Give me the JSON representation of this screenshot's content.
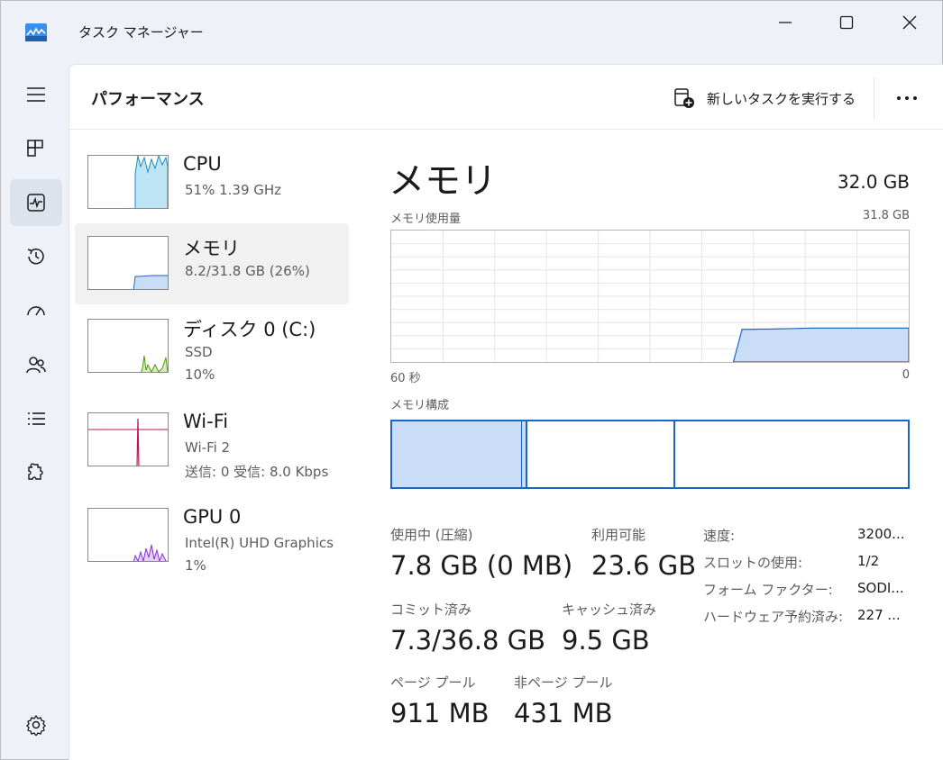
{
  "window": {
    "title": "タスク マネージャー"
  },
  "colors": {
    "accent": "#0b5cd5",
    "memory_line": "#1e65c2",
    "memory_fill": "#c9ddf7",
    "cpu_fill": "#bde5f5",
    "cpu_line": "#1d8bb8",
    "disk_line": "#4e9a06",
    "wifi_line": "#c0125e",
    "gpu_line": "#8a2be2"
  },
  "rail": {
    "items": [
      {
        "name": "menu-icon"
      },
      {
        "name": "processes-icon"
      },
      {
        "name": "performance-icon",
        "active": true
      },
      {
        "name": "app-history-icon"
      },
      {
        "name": "startup-apps-icon"
      },
      {
        "name": "users-icon"
      },
      {
        "name": "details-icon"
      },
      {
        "name": "services-icon"
      },
      {
        "name": "settings-icon"
      }
    ]
  },
  "header": {
    "title": "パフォーマンス",
    "run_task_label": "新しいタスクを実行する"
  },
  "perf_list": [
    {
      "name": "CPU",
      "sub1": "51%  1.39 GHz",
      "sub2": ""
    },
    {
      "name": "メモリ",
      "sub1": "8.2/31.8 GB (26%)",
      "sub2": ""
    },
    {
      "name": "ディスク 0 (C:)",
      "sub1": "SSD",
      "sub2": "10%"
    },
    {
      "name": "Wi-Fi",
      "sub1": "Wi-Fi 2",
      "sub2": "送信: 0  受信: 8.0 Kbps"
    },
    {
      "name": "GPU 0",
      "sub1": "Intel(R) UHD Graphics",
      "sub2": "1%"
    }
  ],
  "detail": {
    "title": "メモリ",
    "total": "32.0 GB",
    "usage_label": "メモリ使用量",
    "usage_max": "31.8 GB",
    "axis_left": "60 秒",
    "axis_right": "0",
    "composition_label": "メモリ構成",
    "composition": {
      "in_use_fraction": 0.25,
      "modified_fraction": 0.012,
      "standby_fraction": 0.287,
      "free_fraction": 0.451
    },
    "usage_history": [
      0,
      0,
      0,
      0,
      0,
      0,
      0,
      0,
      0,
      0,
      0,
      0,
      0,
      0,
      0,
      0,
      0,
      0,
      0,
      0,
      0,
      0,
      0,
      0,
      0,
      0,
      0,
      0,
      0,
      0,
      0,
      0,
      0,
      0,
      0,
      0,
      0,
      0,
      0,
      0,
      7.9,
      7.9,
      7.95,
      7.95,
      8.0,
      8.05,
      8.1,
      8.15,
      8.2,
      8.2,
      8.2,
      8.2,
      8.2,
      8.2,
      8.2,
      8.2,
      8.2,
      8.2,
      8.2,
      8.2
    ],
    "stats": {
      "in_use_label": "使用中 (圧縮)",
      "in_use_value": "7.8 GB (0 MB)",
      "available_label": "利用可能",
      "available_value": "23.6 GB",
      "committed_label": "コミット済み",
      "committed_value": "7.3/36.8 GB",
      "cached_label": "キャッシュ済み",
      "cached_value": "9.5 GB",
      "paged_label": "ページ プール",
      "paged_value": "911 MB",
      "nonpaged_label": "非ページ プール",
      "nonpaged_value": "431 MB"
    },
    "props": [
      {
        "label": "速度:",
        "value": "3200..."
      },
      {
        "label": "スロットの使用:",
        "value": "1/2"
      },
      {
        "label": "フォーム ファクター:",
        "value": "SODI..."
      },
      {
        "label": "ハードウェア予約済み:",
        "value": "227 ..."
      }
    ]
  }
}
